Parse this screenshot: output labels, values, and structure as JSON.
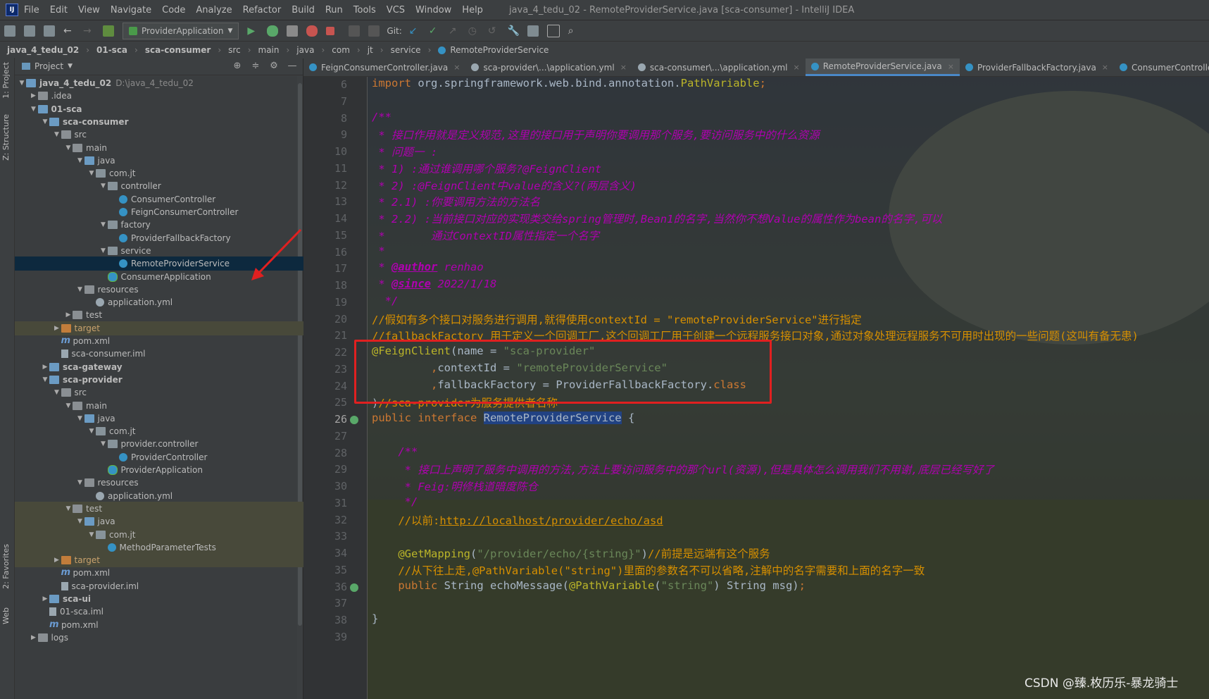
{
  "app": {
    "title": "java_4_tedu_02 - RemoteProviderService.java [sca-consumer] - IntelliJ IDEA",
    "menu": [
      "File",
      "Edit",
      "View",
      "Navigate",
      "Code",
      "Analyze",
      "Refactor",
      "Build",
      "Run",
      "Tools",
      "VCS",
      "Window",
      "Help"
    ]
  },
  "toolbar": {
    "run_config": "ProviderApplication",
    "git_label": "Git:"
  },
  "breadcrumb": [
    "java_4_tedu_02",
    "01-sca",
    "sca-consumer",
    "src",
    "main",
    "java",
    "com",
    "jt",
    "service",
    "RemoteProviderService"
  ],
  "sidebar": {
    "project_tab": "1: Project",
    "structure_tab": "Z: Structure",
    "favorites_tab": "2: Favorites",
    "web_tab": "Web"
  },
  "project_panel": {
    "title": "Project",
    "tree": [
      {
        "label": "java_4_tedu_02",
        "extra": "D:\\java_4_tedu_02",
        "depth": 0,
        "icon": "bfolder",
        "arrow": "▼",
        "bold": true
      },
      {
        "label": ".idea",
        "depth": 1,
        "icon": "folder",
        "arrow": "▶"
      },
      {
        "label": "01-sca",
        "depth": 1,
        "icon": "bfolder",
        "arrow": "▼",
        "bold": true
      },
      {
        "label": "sca-consumer",
        "depth": 2,
        "icon": "bfolder",
        "arrow": "▼",
        "bold": true
      },
      {
        "label": "src",
        "depth": 3,
        "icon": "folder",
        "arrow": "▼"
      },
      {
        "label": "main",
        "depth": 4,
        "icon": "folder",
        "arrow": "▼"
      },
      {
        "label": "java",
        "depth": 5,
        "icon": "bfolder",
        "arrow": "▼"
      },
      {
        "label": "com.jt",
        "depth": 6,
        "icon": "pkg",
        "arrow": "▼"
      },
      {
        "label": "controller",
        "depth": 7,
        "icon": "pkg",
        "arrow": "▼"
      },
      {
        "label": "ConsumerController",
        "depth": 8,
        "icon": "cls",
        "arrow": ""
      },
      {
        "label": "FeignConsumerController",
        "depth": 8,
        "icon": "cls",
        "arrow": ""
      },
      {
        "label": "factory",
        "depth": 7,
        "icon": "pkg",
        "arrow": "▼"
      },
      {
        "label": "ProviderFallbackFactory",
        "depth": 8,
        "icon": "cls",
        "arrow": ""
      },
      {
        "label": "service",
        "depth": 7,
        "icon": "pkg",
        "arrow": "▼"
      },
      {
        "label": "RemoteProviderService",
        "depth": 8,
        "icon": "cls",
        "arrow": "",
        "selected": true
      },
      {
        "label": "ConsumerApplication",
        "depth": 7,
        "icon": "app",
        "arrow": ""
      },
      {
        "label": "resources",
        "depth": 5,
        "icon": "folder",
        "arrow": "▼"
      },
      {
        "label": "application.yml",
        "depth": 6,
        "icon": "yml",
        "arrow": ""
      },
      {
        "label": "test",
        "depth": 4,
        "icon": "folder",
        "arrow": "▶"
      },
      {
        "label": "target",
        "depth": 3,
        "icon": "ofolder",
        "arrow": "▶",
        "yellow": true
      },
      {
        "label": "pom.xml",
        "depth": 3,
        "icon": "mvn",
        "arrow": ""
      },
      {
        "label": "sca-consumer.iml",
        "depth": 3,
        "icon": "iml",
        "arrow": ""
      },
      {
        "label": "sca-gateway",
        "depth": 2,
        "icon": "bfolder",
        "arrow": "▶",
        "bold": true
      },
      {
        "label": "sca-provider",
        "depth": 2,
        "icon": "bfolder",
        "arrow": "▼",
        "bold": true
      },
      {
        "label": "src",
        "depth": 3,
        "icon": "folder",
        "arrow": "▼"
      },
      {
        "label": "main",
        "depth": 4,
        "icon": "folder",
        "arrow": "▼"
      },
      {
        "label": "java",
        "depth": 5,
        "icon": "bfolder",
        "arrow": "▼"
      },
      {
        "label": "com.jt",
        "depth": 6,
        "icon": "pkg",
        "arrow": "▼"
      },
      {
        "label": "provider.controller",
        "depth": 7,
        "icon": "pkg",
        "arrow": "▼"
      },
      {
        "label": "ProviderController",
        "depth": 8,
        "icon": "cls",
        "arrow": ""
      },
      {
        "label": "ProviderApplication",
        "depth": 7,
        "icon": "app",
        "arrow": ""
      },
      {
        "label": "resources",
        "depth": 5,
        "icon": "folder",
        "arrow": "▼"
      },
      {
        "label": "application.yml",
        "depth": 6,
        "icon": "yml",
        "arrow": ""
      },
      {
        "label": "test",
        "depth": 4,
        "icon": "folder",
        "arrow": "▼",
        "yellow": true
      },
      {
        "label": "java",
        "depth": 5,
        "icon": "bfolder",
        "arrow": "▼",
        "yellow": true
      },
      {
        "label": "com.jt",
        "depth": 6,
        "icon": "pkg",
        "arrow": "▼",
        "yellow": true
      },
      {
        "label": "MethodParameterTests",
        "depth": 7,
        "icon": "cls",
        "arrow": "",
        "yellow": true
      },
      {
        "label": "target",
        "depth": 3,
        "icon": "ofolder",
        "arrow": "▶",
        "yellow": true
      },
      {
        "label": "pom.xml",
        "depth": 3,
        "icon": "mvn",
        "arrow": ""
      },
      {
        "label": "sca-provider.iml",
        "depth": 3,
        "icon": "iml",
        "arrow": ""
      },
      {
        "label": "sca-ui",
        "depth": 2,
        "icon": "bfolder",
        "arrow": "▶",
        "bold": true
      },
      {
        "label": "01-sca.iml",
        "depth": 2,
        "icon": "iml",
        "arrow": ""
      },
      {
        "label": "pom.xml",
        "depth": 2,
        "icon": "mvn",
        "arrow": ""
      },
      {
        "label": "logs",
        "depth": 1,
        "icon": "folder",
        "arrow": "▶"
      }
    ]
  },
  "editor_tabs": [
    {
      "label": "FeignConsumerController.java",
      "icon": "class"
    },
    {
      "label": "sca-provider\\...\\application.yml",
      "icon": "yml"
    },
    {
      "label": "sca-consumer\\...\\application.yml",
      "icon": "yml"
    },
    {
      "label": "RemoteProviderService.java",
      "icon": "class",
      "active": true
    },
    {
      "label": "ProviderFallbackFactory.java",
      "icon": "class"
    },
    {
      "label": "ConsumerController.jav",
      "icon": "class"
    }
  ],
  "editor": {
    "current_line": 26,
    "lines": [
      {
        "n": 6,
        "tokens": [
          [
            "kw",
            "import "
          ],
          [
            "plain",
            "org.springframework.web.bind.annotation."
          ],
          [
            "ann",
            "PathVariable"
          ],
          [
            "kw",
            ";"
          ]
        ]
      },
      {
        "n": 7,
        "tokens": []
      },
      {
        "n": 8,
        "tokens": [
          [
            "doc",
            "/**"
          ]
        ]
      },
      {
        "n": 9,
        "tokens": [
          [
            "doc",
            " * 接口作用就是定义规范,这里的接口用于声明你要调用那个服务,要访问服务中的什么资源"
          ]
        ]
      },
      {
        "n": 10,
        "tokens": [
          [
            "doc",
            " * 问题一 :"
          ]
        ]
      },
      {
        "n": 11,
        "tokens": [
          [
            "doc",
            " * 1) :通过谁调用哪个服务?@FeignClient"
          ]
        ]
      },
      {
        "n": 12,
        "tokens": [
          [
            "doc",
            " * 2) :@FeignClient中value的含义?(两层含义)"
          ]
        ]
      },
      {
        "n": 13,
        "tokens": [
          [
            "doc",
            " * 2.1) :你要调用方法的方法名"
          ]
        ]
      },
      {
        "n": 14,
        "tokens": [
          [
            "doc",
            " * 2.2) :当前接口对应的实现类交给spring管理时,Bean1的名字,当然你不想Value的属性作为bean的名字,可以"
          ]
        ]
      },
      {
        "n": 15,
        "tokens": [
          [
            "doc",
            " *       通过ContextID属性指定一个名字"
          ]
        ]
      },
      {
        "n": 16,
        "tokens": [
          [
            "doc",
            " *"
          ]
        ]
      },
      {
        "n": 17,
        "tokens": [
          [
            "doc",
            " * "
          ],
          [
            "doctag",
            "@author"
          ],
          [
            "doc",
            " renhao"
          ]
        ]
      },
      {
        "n": 18,
        "tokens": [
          [
            "doc",
            " * "
          ],
          [
            "doctag",
            "@since"
          ],
          [
            "doc",
            " 2022/1/18"
          ]
        ]
      },
      {
        "n": 19,
        "tokens": [
          [
            "doc",
            "  */"
          ]
        ]
      },
      {
        "n": 20,
        "tokens": [
          [
            "cmt",
            "//假如有多个接口对服务进行调用,就得使用contextId = \"remoteProviderService\"进行指定"
          ]
        ]
      },
      {
        "n": 21,
        "tokens": [
          [
            "cmt",
            "//fallbackFactory 用于定义一个回调工厂,这个回调工厂用于创建一个远程服务接口对象,通过对象处理远程服务不可用时出现的一些问题(这叫有备无患)"
          ]
        ]
      },
      {
        "n": 22,
        "tokens": [
          [
            "ann",
            "@FeignClient"
          ],
          [
            "plain",
            "(name = "
          ],
          [
            "str",
            "\"sca-provider\""
          ]
        ]
      },
      {
        "n": 23,
        "tokens": [
          [
            "plain",
            "         "
          ],
          [
            "kw",
            ","
          ],
          [
            "plain",
            "contextId = "
          ],
          [
            "str",
            "\"remoteProviderService\""
          ]
        ]
      },
      {
        "n": 24,
        "tokens": [
          [
            "plain",
            "         "
          ],
          [
            "kw",
            ","
          ],
          [
            "plain",
            "fallbackFactory = ProviderFallbackFactory."
          ],
          [
            "kw",
            "class"
          ]
        ]
      },
      {
        "n": 25,
        "tokens": [
          [
            "plain",
            ")"
          ],
          [
            "cmt",
            "//sca-provider为服务提供者名称"
          ]
        ]
      },
      {
        "n": 26,
        "tokens": [
          [
            "kw",
            "public interface "
          ],
          [
            "iface",
            "RemoteProviderService"
          ],
          [
            "plain",
            " {"
          ]
        ]
      },
      {
        "n": 27,
        "tokens": []
      },
      {
        "n": 28,
        "tokens": [
          [
            "doc",
            "    /**"
          ]
        ]
      },
      {
        "n": 29,
        "tokens": [
          [
            "doc",
            "     * 接口上声明了服务中调用的方法,方法上要访问服务中的那个url(资源),但是具体怎么调用我们不用谢,底层已经写好了"
          ]
        ]
      },
      {
        "n": 30,
        "tokens": [
          [
            "doc",
            "     * Feig:明修栈道暗度陈仓"
          ]
        ]
      },
      {
        "n": 31,
        "tokens": [
          [
            "doc",
            "     */"
          ]
        ]
      },
      {
        "n": 32,
        "tokens": [
          [
            "cmt",
            "    //以前:"
          ],
          [
            "link",
            "http://localhost/provider/echo/asd"
          ]
        ]
      },
      {
        "n": 33,
        "tokens": []
      },
      {
        "n": 34,
        "tokens": [
          [
            "ann",
            "    @GetMapping"
          ],
          [
            "plain",
            "("
          ],
          [
            "str",
            "\"/provider/echo/{string}\""
          ],
          [
            "plain",
            ")"
          ],
          [
            "cmt",
            "//前提是远端有这个服务"
          ]
        ]
      },
      {
        "n": 35,
        "tokens": [
          [
            "cmt",
            "    //从下往上走,@PathVariable(\"string\")里面的参数名不可以省略,注解中的名字需要和上面的名字一致"
          ]
        ]
      },
      {
        "n": 36,
        "tokens": [
          [
            "kw",
            "    public "
          ],
          [
            "plain",
            "String echoMessage("
          ],
          [
            "ann",
            "@PathVariable"
          ],
          [
            "plain",
            "("
          ],
          [
            "str",
            "\"string\""
          ],
          [
            "plain",
            ") String msg)"
          ],
          [
            "kw",
            ";"
          ]
        ]
      },
      {
        "n": 37,
        "tokens": []
      },
      {
        "n": 38,
        "tokens": [
          [
            "plain",
            "}"
          ]
        ]
      },
      {
        "n": 39,
        "tokens": []
      }
    ]
  },
  "watermark": "CSDN @臻.枚历乐-暴龙骑士",
  "colors": {
    "highlight_box": "#e02020",
    "selection": "#0d293e",
    "active_tab_underline": "#4a88c7"
  }
}
